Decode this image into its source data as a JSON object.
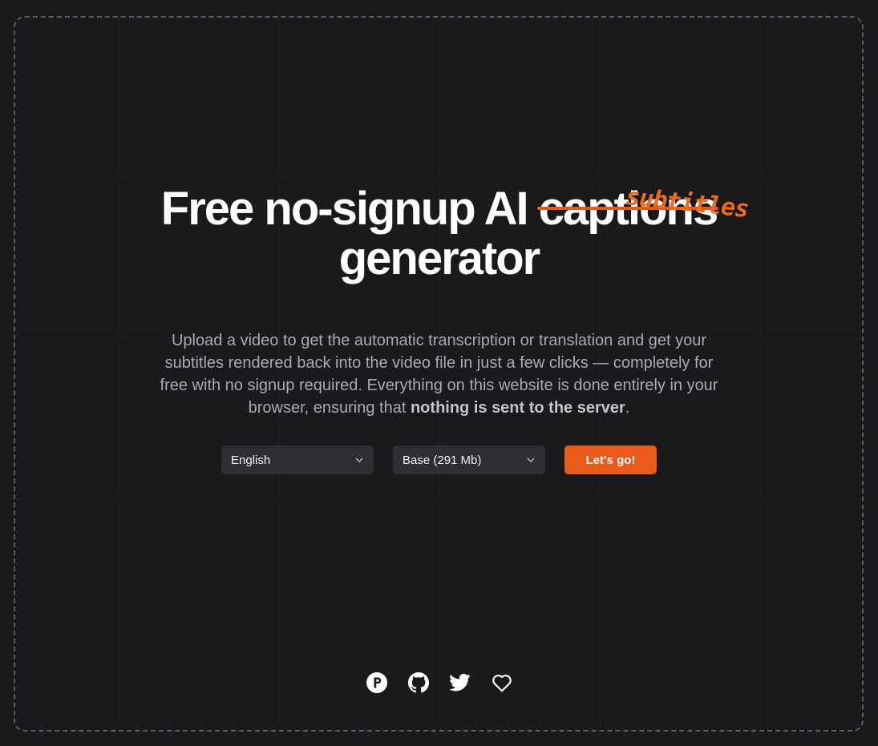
{
  "hero": {
    "headline_line1_prefix": "Free no-signup AI ",
    "headline_struck_word": "captions",
    "headline_line2": "generator",
    "handwritten_word": "subtitles",
    "description_main": "Upload a video to get the automatic transcription or translation and get your subtitles rendered back into the video file in just a few clicks — completely for free with no signup required. Everything on this website is done entirely in your browser, ensuring that ",
    "description_bold": "nothing is sent to the server",
    "description_end": "."
  },
  "controls": {
    "language_value": "English",
    "model_value": "Base (291 Mb)",
    "go_label": "Let's go!"
  },
  "social": {
    "icons": [
      "product-hunt-icon",
      "github-icon",
      "twitter-icon",
      "heart-icon"
    ]
  },
  "colors": {
    "accent": "#e8591a",
    "background": "#1a1a1d",
    "select_bg": "#2e2e33"
  }
}
